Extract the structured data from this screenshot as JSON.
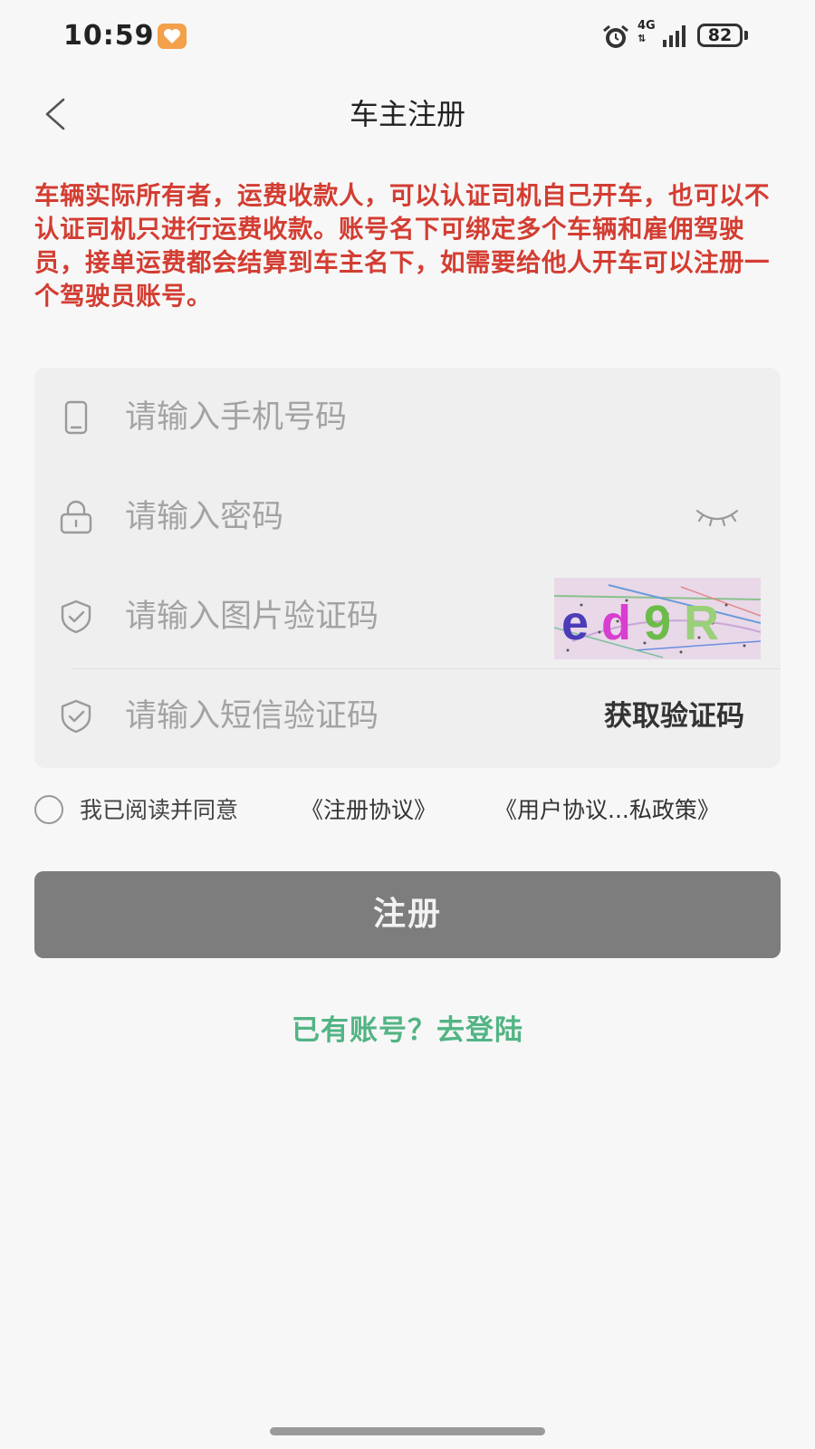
{
  "status_bar": {
    "time": "10:59",
    "network": "4G",
    "battery": "82"
  },
  "nav": {
    "title": "车主注册"
  },
  "notice": {
    "text": "车辆实际所有者，运费收款人，可以认证司机自己开车，也可以不认证司机只进行运费收款。账号名下可绑定多个车辆和雇佣驾驶员，接单运费都会结算到车主名下，如需要给他人开车可以注册一个驾驶员账号。",
    "color": "#d33d32"
  },
  "form": {
    "phone_placeholder": "请输入手机号码",
    "password_placeholder": "请输入密码",
    "captcha_placeholder": "请输入图片验证码",
    "captcha_text": "ed9R",
    "sms_placeholder": "请输入短信验证码",
    "get_code_label": "获取验证码"
  },
  "agreement": {
    "text": "我已阅读并同意",
    "link_register": "《注册协议》",
    "link_privacy": "《用户协议...私政策》"
  },
  "register_button": {
    "label": "注册",
    "color": "#7d7d7d"
  },
  "login_link": {
    "label": "已有账号？去登陆",
    "color": "#52b484"
  }
}
